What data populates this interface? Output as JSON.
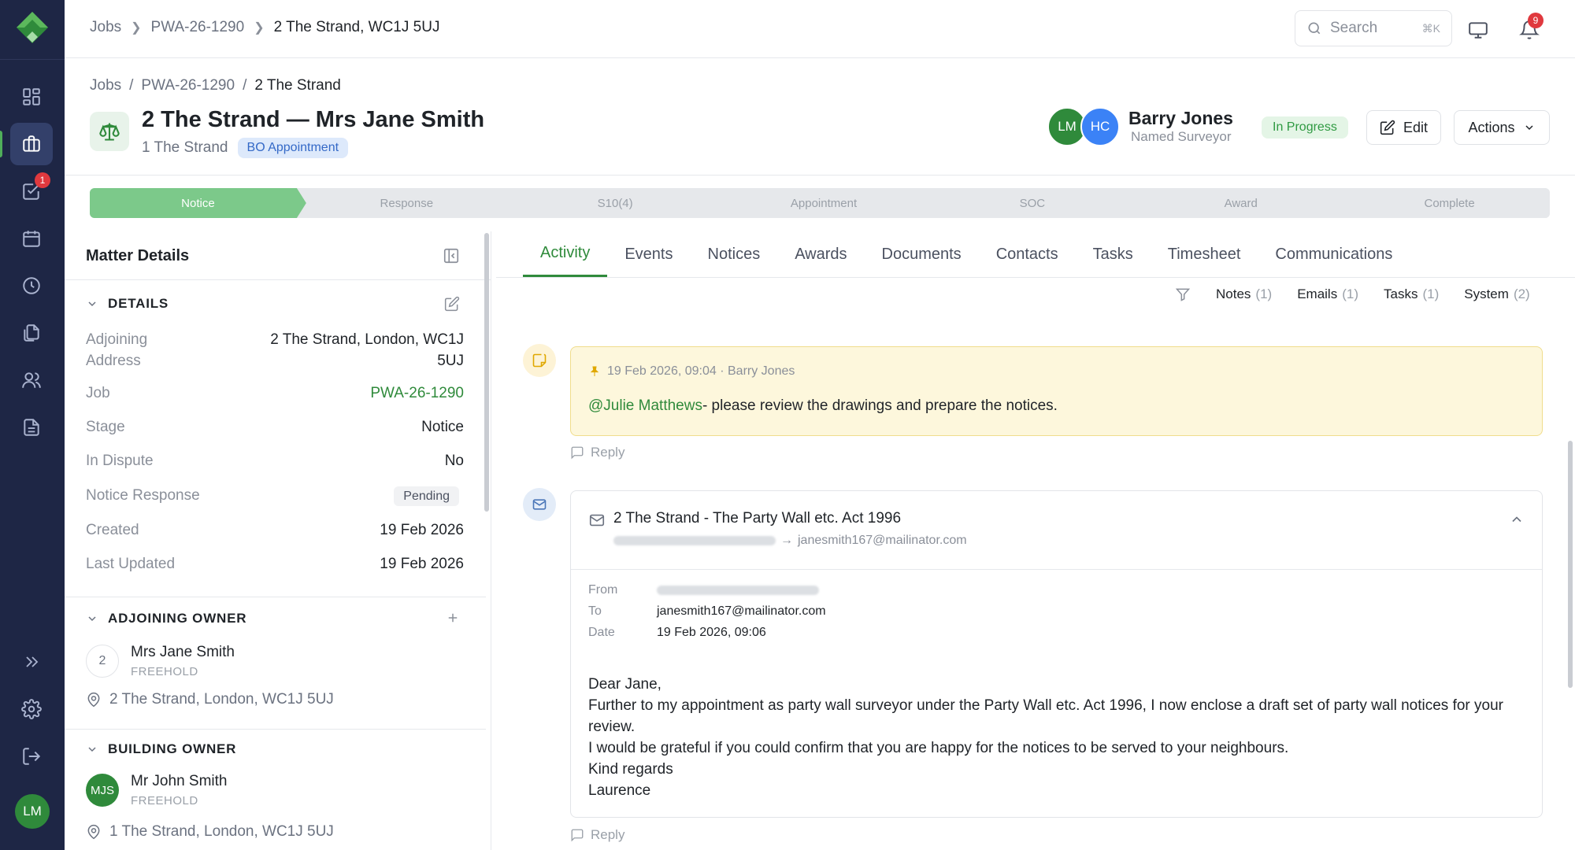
{
  "topbar": {
    "breadcrumbs": [
      "Jobs",
      "PWA-26-1290",
      "2 The Strand, WC1J 5UJ"
    ],
    "search_placeholder": "Search",
    "search_shortcut": "⌘K",
    "notification_count": "9"
  },
  "rail": {
    "tasks_badge": "1",
    "user_initials": "LM",
    "items": [
      "dashboard",
      "jobs",
      "tasks",
      "calendar",
      "timesheet",
      "documents",
      "contacts",
      "reports"
    ]
  },
  "page": {
    "breadcrumbs": [
      "Jobs",
      "PWA-26-1290",
      "2 The Strand"
    ],
    "title": "2 The Strand — Mrs Jane Smith",
    "subtitle": "1 The Strand",
    "tag": "BO Appointment",
    "avatars": [
      {
        "initials": "LM",
        "color": "#2f8a3b"
      },
      {
        "initials": "HC",
        "color": "#3b82f6"
      }
    ],
    "surveyor_name": "Barry Jones",
    "surveyor_role": "Named Surveyor",
    "status": "In Progress",
    "edit_label": "Edit",
    "actions_label": "Actions"
  },
  "stages": [
    {
      "label": "Notice",
      "done": true
    },
    {
      "label": "Response",
      "done": false
    },
    {
      "label": "S10(4)",
      "done": false
    },
    {
      "label": "Appointment",
      "done": false
    },
    {
      "label": "SOC",
      "done": false
    },
    {
      "label": "Award",
      "done": false
    },
    {
      "label": "Complete",
      "done": false
    }
  ],
  "panel": {
    "title": "Matter Details",
    "details_heading": "DETAILS",
    "rows": [
      {
        "label": "Adjoining Address",
        "value": "2 The Strand, London, WC1J 5UJ"
      },
      {
        "label": "Job",
        "value": "PWA-26-1290"
      },
      {
        "label": "Stage",
        "value": "Notice"
      },
      {
        "label": "In Dispute",
        "value": "No"
      },
      {
        "label": "Notice Response",
        "value": "Pending"
      },
      {
        "label": "Created",
        "value": "19 Feb 2026"
      },
      {
        "label": "Last Updated",
        "value": "19 Feb 2026"
      }
    ],
    "adjoining_heading": "ADJOINING OWNER",
    "adjoining_owner": {
      "avatar": "2",
      "name": "Mrs Jane Smith",
      "tenure": "FREEHOLD",
      "address": "2 The Strand, London, WC1J 5UJ"
    },
    "building_heading": "BUILDING OWNER",
    "building_owner": {
      "avatar": "MJS",
      "name": "Mr John Smith",
      "tenure": "FREEHOLD",
      "address": "1 The Strand, London, WC1J 5UJ"
    }
  },
  "tabs": [
    "Activity",
    "Events",
    "Notices",
    "Awards",
    "Documents",
    "Contacts",
    "Tasks",
    "Timesheet",
    "Communications"
  ],
  "filters": [
    {
      "label": "Notes",
      "count": "(1)"
    },
    {
      "label": "Emails",
      "count": "(1)"
    },
    {
      "label": "Tasks",
      "count": "(1)"
    },
    {
      "label": "System",
      "count": "(2)"
    }
  ],
  "note": {
    "meta": "19 Feb 2026, 09:04 · Barry Jones",
    "mention": "@Julie Matthews",
    "text": "- please review the drawings and prepare the notices.",
    "reply_label": "Reply"
  },
  "email": {
    "subject": "2 The Strand - The Party Wall etc. Act 1996",
    "to_address": "janesmith167@mailinator.com",
    "from_label": "From",
    "to_label": "To",
    "date_label": "Date",
    "to_value": "janesmith167@mailinator.com",
    "date_value": "19 Feb 2026, 09:06",
    "body": [
      "Dear Jane,",
      "Further to my appointment as party wall surveyor under the Party Wall etc. Act 1996, I now enclose a draft set of party wall notices for your review.",
      "I would be grateful if you could confirm that you are happy for the notices to be served to your neighbours.",
      "Kind regards",
      "Laurence"
    ],
    "reply_label": "Reply"
  },
  "colors": {
    "accent": "#2f8a3b",
    "rail": "#1e2645",
    "stage_done": "#7cc98a",
    "note_bg": "#fdf7dc"
  }
}
